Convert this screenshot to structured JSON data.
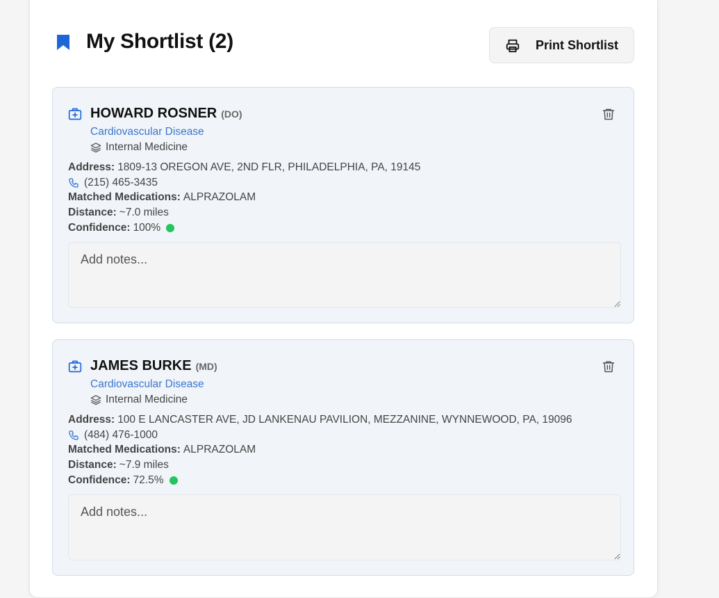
{
  "header": {
    "title": "My Shortlist (2)",
    "print_label": "Print Shortlist"
  },
  "colors": {
    "accent_blue": "#1e66d8",
    "specialty_blue": "#3b76d0",
    "confidence_green": "#22c55e"
  },
  "cards": [
    {
      "name": "HOWARD ROSNER",
      "credential": "(DO)",
      "specialty": "Cardiovascular Disease",
      "subspecialty": "Internal Medicine",
      "address_label": "Address:",
      "address": "1809-13 OREGON AVE, 2ND FLR, PHILADELPHIA, PA, 19145",
      "phone": "(215) 465-3435",
      "meds_label": "Matched Medications:",
      "meds": "ALPRAZOLAM",
      "distance_label": "Distance:",
      "distance": "~7.0 miles",
      "confidence_label": "Confidence:",
      "confidence": "100%",
      "notes_placeholder": "Add notes..."
    },
    {
      "name": "JAMES BURKE",
      "credential": "(MD)",
      "specialty": "Cardiovascular Disease",
      "subspecialty": "Internal Medicine",
      "address_label": "Address:",
      "address": "100 E LANCASTER AVE, JD LANKENAU PAVILION, MEZZANINE, WYNNEWOOD, PA, 19096",
      "phone": "(484) 476-1000",
      "meds_label": "Matched Medications:",
      "meds": "ALPRAZOLAM",
      "distance_label": "Distance:",
      "distance": "~7.9 miles",
      "confidence_label": "Confidence:",
      "confidence": "72.5%",
      "notes_placeholder": "Add notes..."
    }
  ]
}
